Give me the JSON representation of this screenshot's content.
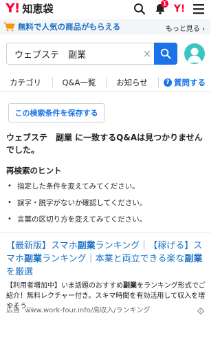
{
  "header": {
    "logo_y": "Y!",
    "logo_text": "知恵袋",
    "notification_count": "1",
    "yj_logo": "Y!"
  },
  "promo": {
    "text": "無料で人気の商品がもらえる",
    "more_label": "もっと見る"
  },
  "search": {
    "value": "ウェブステ　副業",
    "clear_label": "×"
  },
  "nav": {
    "items": [
      {
        "label": "カテゴリ"
      },
      {
        "label": "Q&A一覧"
      },
      {
        "label": "お知らせ"
      },
      {
        "label": "質問する",
        "icon_text": "?"
      }
    ]
  },
  "results": {
    "save_label": "この検索条件を保存する",
    "no_result_text": "ウェブステ　副業 に一致するQ&Aは見つかりませんでした。",
    "hint_title": "再検索のヒント",
    "hints": [
      "指定した条件を変えてみてください。",
      "誤字・脱字がないか確認してください。",
      "言葉の区切り方を変えてみてください。"
    ]
  },
  "ad": {
    "title_parts": [
      "【最新版】スマホ",
      "副業",
      "ランキング｜【稼げる】スマホ",
      "副業",
      "ランキング｜本業と両立できる楽な",
      "副業",
      "を厳選"
    ],
    "desc_parts": [
      "【利用者増加中】いま話題のおすすめ",
      "副業",
      "をランキング形式でご紹介！無料レクチャー付き。スキマ時間を有効活用して収入を増やそう..."
    ],
    "label": "広告",
    "url": "www.work-four.info/高収入/ランキング"
  },
  "colors": {
    "brand_red": "#ff0033",
    "link_blue": "#1a6fc4",
    "accent_blue": "#1a73e8",
    "avatar_teal": "#39c6c3"
  }
}
